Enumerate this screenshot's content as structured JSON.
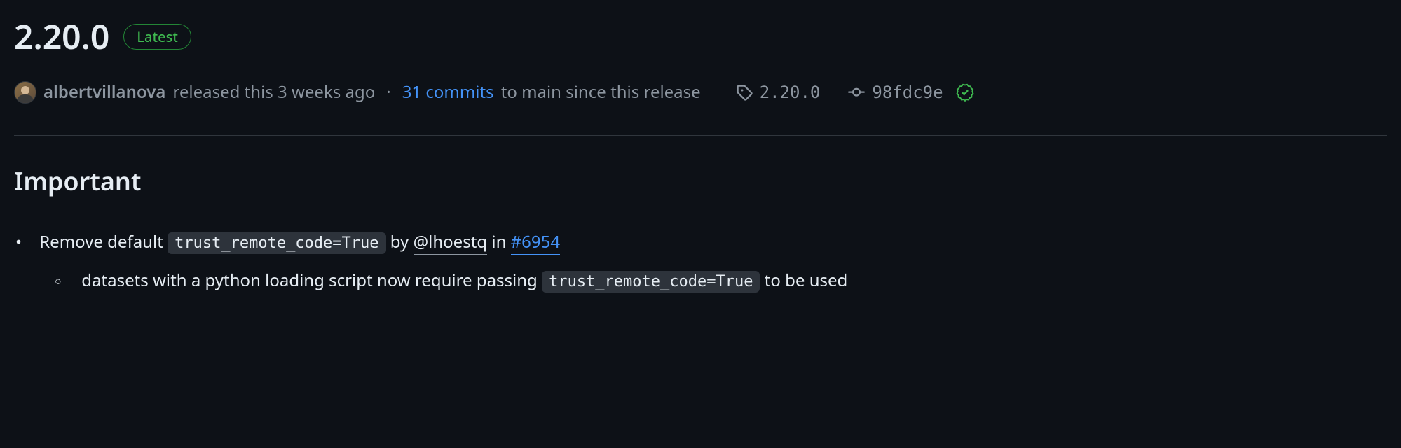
{
  "release": {
    "version": "2.20.0",
    "badge": "Latest",
    "author": "albertvillanova",
    "released_text": "released this 3 weeks ago",
    "commits_count": "31 commits",
    "commits_suffix": "to main since this release",
    "tag": "2.20.0",
    "commit_hash": "98fdc9e"
  },
  "notes": {
    "heading": "Important",
    "item1": {
      "prefix": "Remove default",
      "code": "trust_remote_code=True",
      "by": "by",
      "mention": "@lhoestq",
      "in": "in",
      "pr": "#6954"
    },
    "subitem1": {
      "prefix": "datasets with a python loading script now require passing",
      "code": "trust_remote_code=True",
      "suffix": "to be used"
    }
  }
}
